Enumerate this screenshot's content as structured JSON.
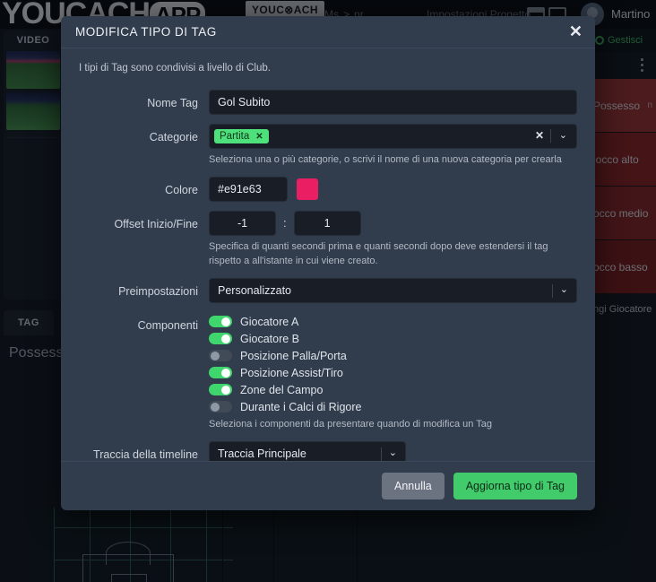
{
  "topbar": {
    "brand_left": "YOUC",
    "brand_mid": "ACH",
    "brand_pill": "APP",
    "brand_chip": "YOUC⊗ACH",
    "breadcrumb_a": "Ms",
    "breadcrumb_sep": ">",
    "breadcrumb_b": "nr",
    "menu_item": "Impostazioni Progetto",
    "user": "Martino"
  },
  "left_panel": {
    "video_title": "VIDEO",
    "tag_tab": "TAG",
    "possesso_label": "Possesso"
  },
  "right_panel": {
    "gestisci": "Gestisci",
    "rows": [
      {
        "label": "Possesso",
        "sub": "n"
      },
      {
        "label": "locco alto",
        "sub": ""
      },
      {
        "label": "occo medio",
        "sub": ""
      },
      {
        "label": "occo basso",
        "sub": ""
      }
    ],
    "add_player": "ngi Giocatore"
  },
  "modal": {
    "title": "MODIFICA TIPO DI TAG",
    "close_icon": "✕",
    "note": "I tipi di Tag sono condivisi a livello di Club.",
    "fields": {
      "name_label": "Nome Tag",
      "name_value": "Gol Subito",
      "categories_label": "Categorie",
      "categories_chips": [
        "Partita"
      ],
      "chip_remove_icon": "✕",
      "categories_clear_icon": "✕",
      "categories_caret_icon": "⌄",
      "categories_hint": "Seleziona una o più categorie, o scrivi il nome di una nuova categoria per crearla",
      "color_label": "Colore",
      "color_value": "#e91e63",
      "color_swatch": "#e91e63",
      "offset_label": "Offset Inizio/Fine",
      "offset_start": "-1",
      "offset_separator": ":",
      "offset_end": "1",
      "offset_hint": "Specifica di quanti secondi prima e quanti secondi dopo deve estendersi il tag rispetto a all'istante in cui viene creato.",
      "presets_label": "Preimpostazioni",
      "presets_value": "Personalizzato",
      "presets_caret_icon": "⌄",
      "components_label": "Componenti",
      "components": [
        {
          "label": "Giocatore A",
          "on": true
        },
        {
          "label": "Giocatore B",
          "on": true
        },
        {
          "label": "Posizione Palla/Porta",
          "on": false
        },
        {
          "label": "Posizione Assist/Tiro",
          "on": true
        },
        {
          "label": "Zone del Campo",
          "on": true
        },
        {
          "label": "Durante i Calci di Rigore",
          "on": false
        }
      ],
      "components_hint": "Seleziona i componenti da presentare quando di modifica un Tag",
      "timeline_label": "Traccia della timeline predefinita",
      "timeline_value": "Traccia Principale",
      "timeline_caret_icon": "⌄"
    },
    "footer": {
      "cancel": "Annulla",
      "submit": "Aggiorna tipo di Tag"
    }
  }
}
